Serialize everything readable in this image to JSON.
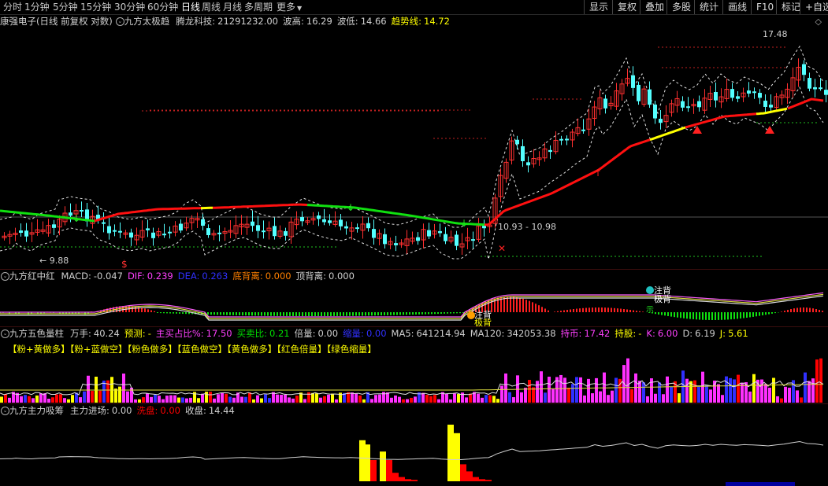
{
  "toolbar": {
    "periods": [
      "分时",
      "1分钟",
      "5分钟",
      "15分钟",
      "30分钟",
      "60分钟",
      "日线",
      "周线",
      "月线",
      "多周期",
      "更多"
    ],
    "active_period": "日线",
    "tools": [
      "显示",
      "复权",
      "叠加",
      "多股",
      "统计",
      "画线",
      "F10",
      "标记",
      "+自选"
    ]
  },
  "main_panel": {
    "stock_title": "康强电子(日线 前复权 对数)",
    "indicator_name": "九方太极趋",
    "items": [
      {
        "label": "腾龙科技:",
        "value": "21291232.00",
        "color": "#d0d0d0"
      },
      {
        "label": "波高:",
        "value": "16.29",
        "color": "#d0d0d0"
      },
      {
        "label": "波低:",
        "value": "14.66",
        "color": "#d0d0d0"
      },
      {
        "label": "趋势线:",
        "value": "14.72",
        "color": "#ffff00"
      }
    ],
    "price_labels": {
      "high": "17.48",
      "low": "9.88",
      "mid": "10.93 - 10.98",
      "markS": "$"
    },
    "colors": {
      "up": "#ff3030",
      "down": "#54ffff",
      "trend_up": "#ff0000",
      "trend_down": "#00e000",
      "trend_mid": "#ffff00"
    }
  },
  "macd_panel": {
    "name": "九方红中红",
    "items": [
      {
        "label": "MACD:",
        "value": "-0.047",
        "color": "#d0d0d0"
      },
      {
        "label": "DIF:",
        "value": "0.239",
        "color": "#ff40ff"
      },
      {
        "label": "DEA:",
        "value": "0.263",
        "color": "#3030ff"
      },
      {
        "label": "底背离:",
        "value": "0.000",
        "color": "#ff8000"
      },
      {
        "label": "顶背离:",
        "value": "0.000",
        "color": "#d0d0d0"
      }
    ],
    "markers": {
      "zhubei": "注背",
      "jibei": "极背",
      "shi": "示"
    }
  },
  "volume_panel": {
    "name": "九方五色量柱",
    "items": [
      {
        "label": "万手:",
        "value": "40.24",
        "color": "#d0d0d0"
      },
      {
        "label": "预测:",
        "value": "-",
        "color": "#ffff00"
      },
      {
        "label": "主买占比%:",
        "value": "17.50",
        "color": "#ff40ff"
      },
      {
        "label": "买卖比:",
        "value": "0.21",
        "color": "#00e000"
      },
      {
        "label": "倍量:",
        "value": "0.00",
        "color": "#d0d0d0"
      },
      {
        "label": "缩量:",
        "value": "0.00",
        "color": "#3030ff"
      },
      {
        "label": "MA5:",
        "value": "641214.94",
        "color": "#d0d0d0"
      },
      {
        "label": "MA120:",
        "value": "342053.38",
        "color": "#d0d0d0"
      },
      {
        "label": "持币:",
        "value": "17.42",
        "color": "#ff40ff"
      },
      {
        "label": "持股:",
        "value": "-",
        "color": "#ffff00"
      },
      {
        "label": "K:",
        "value": "6.00",
        "color": "#ff40ff"
      },
      {
        "label": "D:",
        "value": "6.19",
        "color": "#d0d0d0"
      },
      {
        "label": "J:",
        "value": "5.61",
        "color": "#ffff00"
      }
    ],
    "legend": "【粉+黄做多】【粉+蓝做空】【粉色做多】【蓝色做空】【黄色做多】【红色倍量】【绿色缩量】"
  },
  "capital_panel": {
    "name": "九方主力吸筹",
    "items": [
      {
        "label": "主力进场:",
        "value": "0.00",
        "color": "#d0d0d0"
      },
      {
        "label": "洗盘:",
        "value": "0.00",
        "color": "#ff0000"
      },
      {
        "label": "收盘:",
        "value": "14.44",
        "color": "#d0d0d0"
      }
    ]
  }
}
